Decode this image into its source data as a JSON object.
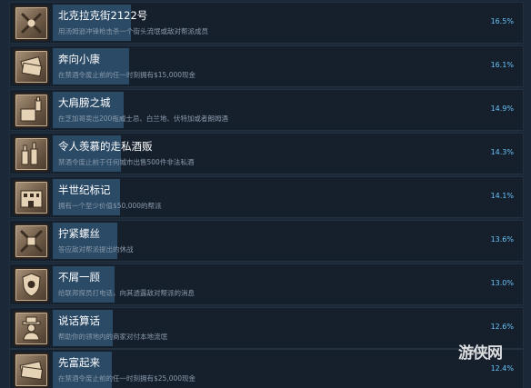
{
  "achievements": [
    {
      "title": "北克拉克街2122号",
      "desc": "用汤姆逊冲锋枪击杀一个街头流氓或敌对帮派成员",
      "pct": "16.5%",
      "progress": 0.165,
      "icon": "crossed-guns-icon"
    },
    {
      "title": "奔向小康",
      "desc": "在禁酒令废止前的任一时刻拥有$15,000现金",
      "pct": "16.1%",
      "progress": 0.161,
      "icon": "cash-stack-icon"
    },
    {
      "title": "大肩膀之城",
      "desc": "在芝加哥卖出200瓶威士忌、白兰地、伏特加或者朗姆酒",
      "pct": "14.9%",
      "progress": 0.149,
      "icon": "bottle-crate-icon"
    },
    {
      "title": "令人羡慕的走私酒贩",
      "desc": "禁酒令废止前于任何城市出售500件非法私酒",
      "pct": "14.3%",
      "progress": 0.143,
      "icon": "bottles-icon"
    },
    {
      "title": "半世纪标记",
      "desc": "拥有一个至少价值$50,000的帮派",
      "pct": "14.1%",
      "progress": 0.141,
      "icon": "building-icon"
    },
    {
      "title": "拧紧螺丝",
      "desc": "答应敌对帮派提出的休战",
      "pct": "13.6%",
      "progress": 0.136,
      "icon": "handshake-icon"
    },
    {
      "title": "不屑一顾",
      "desc": "给联邦探员打电话，向其透露敌对帮派的消息",
      "pct": "13.0%",
      "progress": 0.13,
      "icon": "police-badge-icon"
    },
    {
      "title": "说话算话",
      "desc": "帮助你的领地内的商家对付本地流氓",
      "pct": "12.6%",
      "progress": 0.126,
      "icon": "gangster-icon"
    },
    {
      "title": "先富起来",
      "desc": "在禁酒令废止前的任一时刻拥有$25,000现金",
      "pct": "12.4%",
      "progress": 0.124,
      "icon": "cash-bills-icon"
    }
  ],
  "watermark": "游侠网",
  "colors": {
    "background": "#1b2838",
    "bar": "#2a4a66",
    "percent": "#67c1f5"
  }
}
